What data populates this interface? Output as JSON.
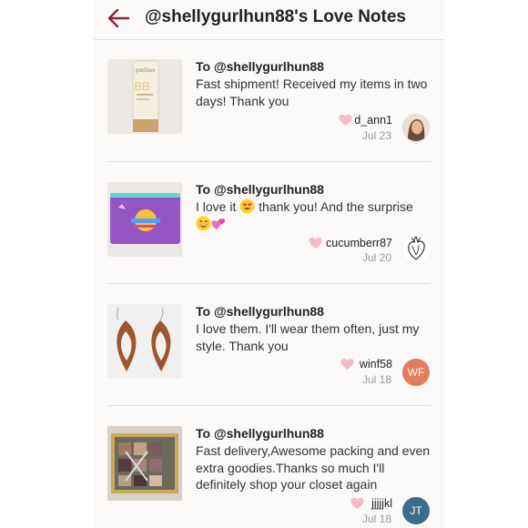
{
  "header": {
    "title": "@shellygurlhun88's Love Notes"
  },
  "colors": {
    "accent": "#8e2437",
    "heart": "#f7b9c6",
    "avatar_wf": "#e17c60",
    "avatar_jt": "#3d6e87"
  },
  "notes": [
    {
      "to": "To @shellygurlhun88",
      "message": "Fast shipment! Received my items in two days! Thank you",
      "username": "d_ann1",
      "date": "Jul 23",
      "thumb_icon": "bb-cream-tube-icon",
      "avatar_icon": "user-photo-icon"
    },
    {
      "to": "To @shellygurlhun88",
      "message_before": "I love it ",
      "message_middle": " thank you! And the surprise",
      "username": "cucumberr87",
      "date": "Jul 20",
      "thumb_icon": "purple-pouch-icon",
      "avatar_icon": "anatomical-heart-icon"
    },
    {
      "to": "To @shellygurlhun88",
      "message": "I love them. I'll wear them often, just my style. Thank you",
      "username": "winf58",
      "date": "Jul 18",
      "thumb_icon": "wooden-earrings-icon",
      "avatar_initials": "WF"
    },
    {
      "to": "To @shellygurlhun88",
      "message": "Fast delivery,Awesome packing and even extra goodies.Thanks so much I'll definitely shop your closet again",
      "username": "jjjjjkl",
      "date": "Jul 18",
      "thumb_icon": "eyeshadow-palette-icon",
      "avatar_initials": "JT"
    }
  ]
}
